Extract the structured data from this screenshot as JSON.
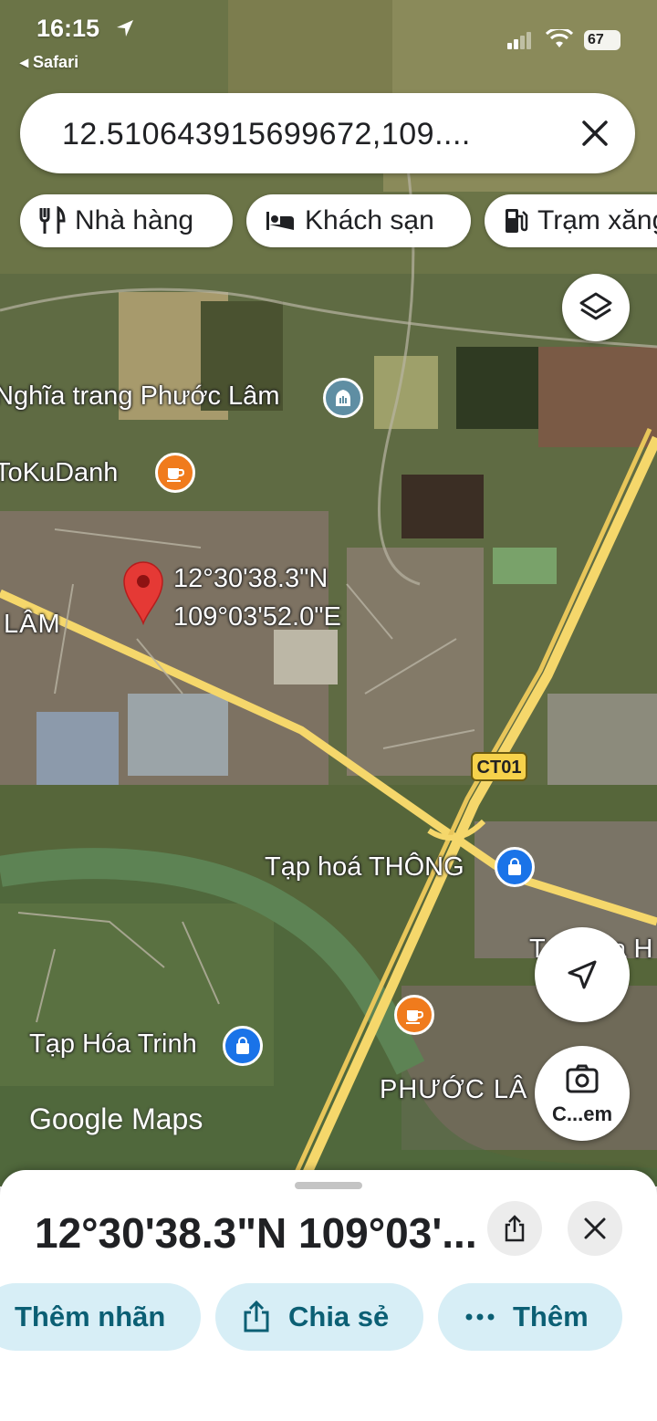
{
  "status_bar": {
    "time": "16:15",
    "back_app": "Safari",
    "battery": "67"
  },
  "search": {
    "query": "12.510643915699672,109...."
  },
  "chips": [
    {
      "label": "Nhà hàng",
      "icon": "restaurant-icon"
    },
    {
      "label": "Khách sạn",
      "icon": "hotel-icon"
    },
    {
      "label": "Trạm xăng",
      "icon": "gas-station-icon"
    }
  ],
  "map": {
    "labels": {
      "cemetery": "Nghĩa trang Phước Lâm",
      "cafe": "ToKuDanh",
      "pin_lat": "12°30'38.3\"N",
      "pin_lng": "109°03'52.0\"E",
      "area_left": "LÂM",
      "shop_thong": "Tạp hoá THÔNG",
      "shop_right": "Tạp hóa H",
      "shop_trinh": "Tạp Hóa Trinh",
      "area_bottom": "PHƯỚC LÂ",
      "camera_caption": "C...em"
    },
    "road_shield": "CT01",
    "branding": "Google Maps",
    "colors": {
      "pin": "#e53935",
      "cafe_poi": "#f07b1d",
      "shop_poi": "#1a73e8",
      "cemetery_poi": "#5f8ea3",
      "road": "#f5d76b"
    }
  },
  "sheet": {
    "title": "12°30'38.3\"N 109°03'...",
    "actions": [
      {
        "label": "Thêm nhãn"
      },
      {
        "label": "Chia sẻ",
        "icon": "share-icon"
      },
      {
        "label": "Thêm",
        "icon": "more-icon"
      }
    ]
  }
}
